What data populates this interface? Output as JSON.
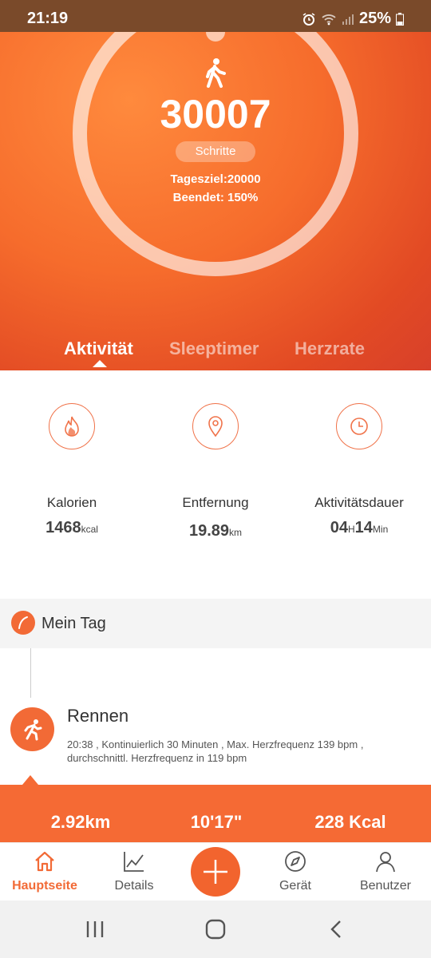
{
  "status_bar": {
    "time": "21:19",
    "battery": "25%"
  },
  "hero": {
    "steps": "30007",
    "steps_label": "Schritte",
    "goal": "Tagesziel:20000",
    "completed": "Beendet: 150%",
    "tabs": [
      "Aktivität",
      "Sleeptimer",
      "Herzrate"
    ]
  },
  "stats": [
    {
      "label": "Kalorien",
      "value": "1468",
      "unit": "kcal",
      "icon": "flame-icon"
    },
    {
      "label": "Entfernung",
      "value": "19.89",
      "unit": "km",
      "icon": "location-pin-icon"
    },
    {
      "label": "Aktivitätsdauer",
      "value_h": "04",
      "unit_h": "H",
      "value_m": "14",
      "unit_m": "Min",
      "icon": "clock-icon"
    }
  ],
  "my_day": {
    "title": "Mein Tag",
    "activity_title": "Rennen",
    "activity_detail": "20:38 , Kontinuierlich 30 Minuten , Max. Herzfrequenz 139 bpm , durchschnittl. Herzfrequenz in 119 bpm"
  },
  "summary": {
    "distance": "2.92km",
    "pace": "10'17\"",
    "calories": "228 Kcal"
  },
  "nav": {
    "home": "Hauptseite",
    "details": "Details",
    "device": "Gerät",
    "user": "Benutzer"
  },
  "colors": {
    "accent": "#f26a36",
    "hero_start": "#ff8a3d",
    "hero_end": "#d8402a"
  }
}
